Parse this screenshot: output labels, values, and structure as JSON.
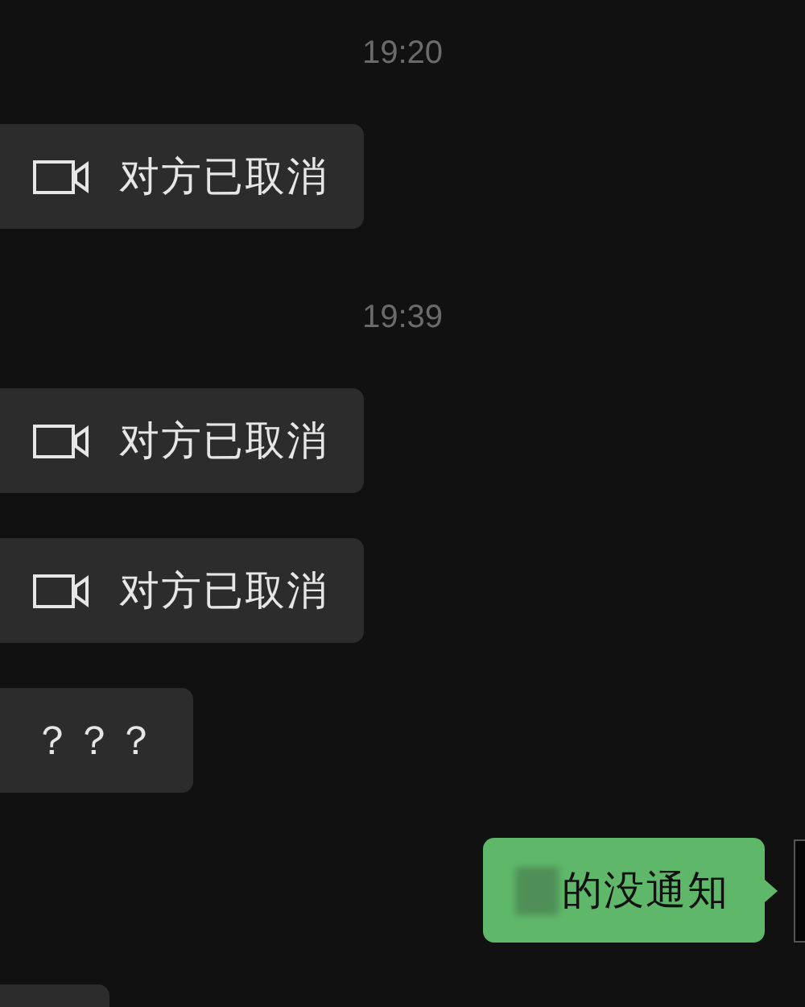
{
  "messages": [
    {
      "kind": "time",
      "text": "19:20"
    },
    {
      "kind": "call",
      "outgoing": false,
      "text": "对方已取消"
    },
    {
      "kind": "time",
      "text": "19:39"
    },
    {
      "kind": "call",
      "outgoing": false,
      "text": "对方已取消"
    },
    {
      "kind": "call",
      "outgoing": false,
      "text": "对方已取消"
    },
    {
      "kind": "text",
      "outgoing": false,
      "text": "？？？"
    },
    {
      "kind": "text",
      "outgoing": true,
      "redacted": true,
      "text": "的没通知"
    },
    {
      "kind": "partial",
      "outgoing": false
    }
  ]
}
